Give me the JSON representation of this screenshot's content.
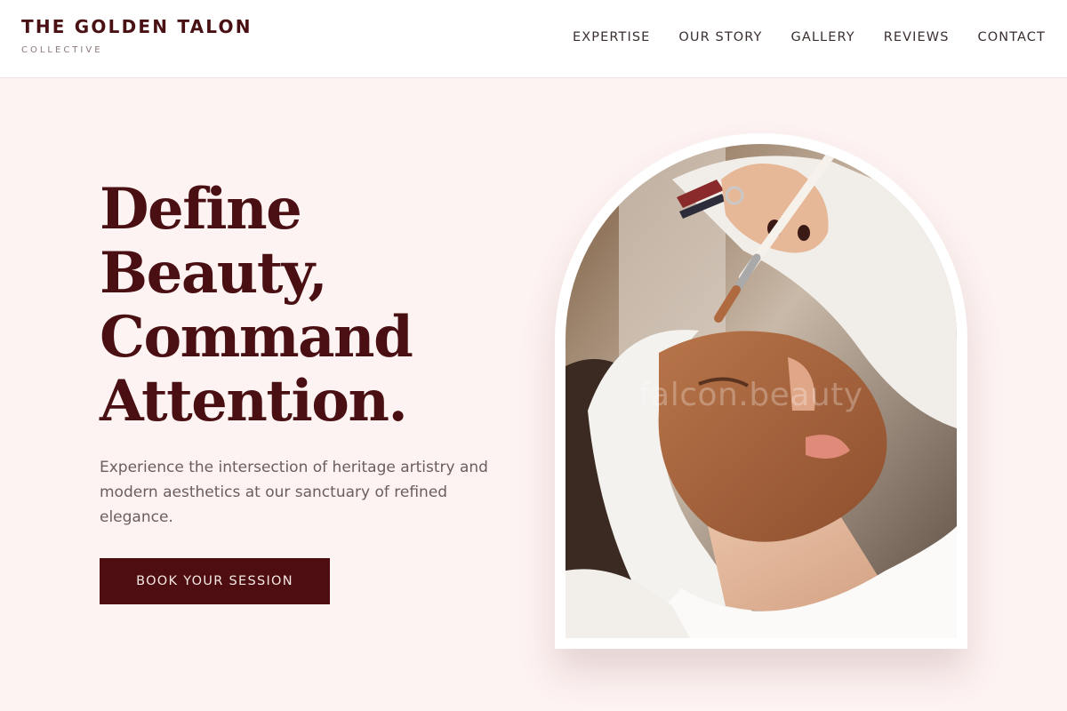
{
  "header": {
    "brand_title": "THE GOLDEN TALON",
    "brand_subtitle": "COLLECTIVE",
    "nav": [
      {
        "label": "EXPERTISE"
      },
      {
        "label": "OUR STORY"
      },
      {
        "label": "GALLERY"
      },
      {
        "label": "REVIEWS"
      },
      {
        "label": "CONTACT"
      }
    ]
  },
  "hero": {
    "title_lines": [
      "Define",
      "Beauty,",
      "Command",
      "Attention."
    ],
    "subtitle": "Experience the intersection of heritage artistry and modern aesthetics at our sanctuary of refined elegance.",
    "cta_label": "BOOK YOUR SESSION"
  },
  "image": {
    "watermark": "falcon.beauty",
    "subject": "facial-treatment-photo"
  },
  "colors": {
    "brand": "#4a1114",
    "accent": "#4e0d10",
    "page_background": "#fdf3f2",
    "header_background": "#ffffff"
  }
}
